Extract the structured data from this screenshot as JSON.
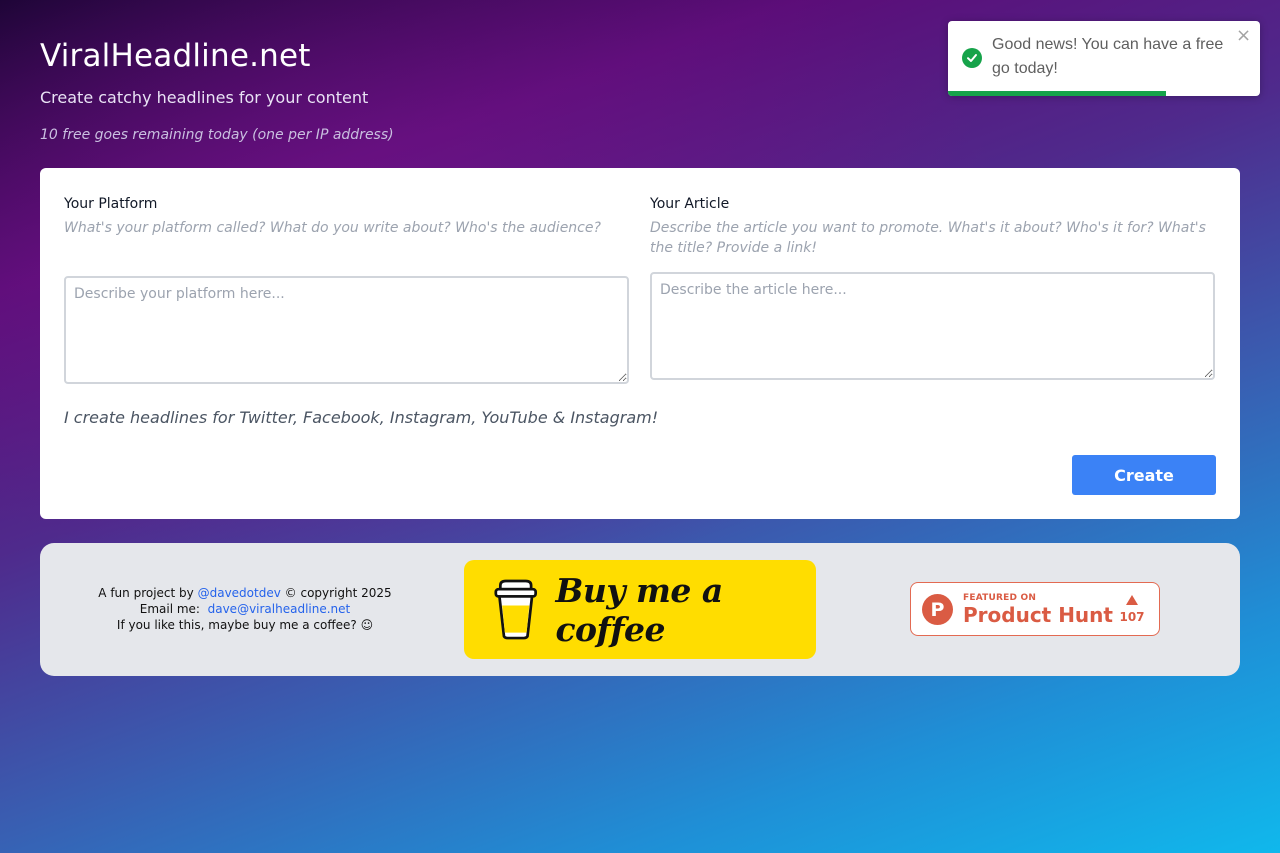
{
  "header": {
    "title": "ViralHeadline.net",
    "tagline": "Create catchy headlines for your content",
    "remaining": "10 free goes remaining today (one per IP address)"
  },
  "form": {
    "platform": {
      "label": "Your Platform",
      "help": "What's your platform called? What do you write about? Who's the audience?",
      "placeholder": "Describe your platform here...",
      "value": ""
    },
    "article": {
      "label": "Your Article",
      "help": "Describe the article you want to promote. What's it about? Who's it for? What's the title? Provide a link!",
      "placeholder": "Describe the article here...",
      "value": ""
    },
    "note": "I create headlines for Twitter, Facebook, Instagram, YouTube & Instagram!",
    "create_label": "Create"
  },
  "footer": {
    "credit_prefix": "A fun project by",
    "credit_handle": "@davedotdev",
    "credit_suffix": "© copyright 2025",
    "email_label": "Email me:",
    "email": "dave@viralheadline.net",
    "coffee_note": "If you like this, maybe buy me a coffee? ☺",
    "bmc_label": "Buy me a coffee",
    "product_hunt": {
      "featured": "FEATURED ON",
      "name": "Product Hunt",
      "logo_letter": "P",
      "upvotes": "107"
    }
  },
  "toast": {
    "message": "Good news! You can have a free go today!",
    "close": "×",
    "progress": 0.7,
    "status": "success"
  },
  "colors": {
    "accent": "#3b82f6",
    "success": "#16a34a",
    "product_hunt": "#da5b43",
    "bmc_yellow": "#ffdd00"
  }
}
